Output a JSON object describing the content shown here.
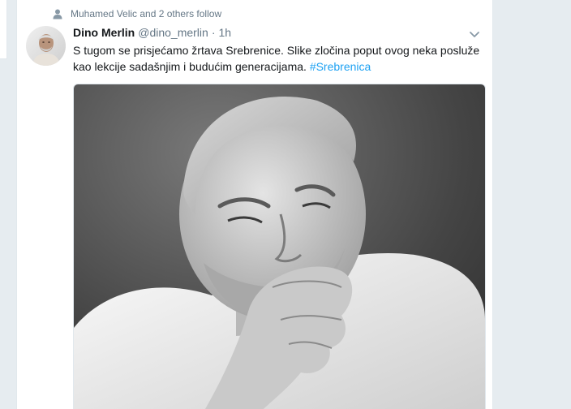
{
  "context": {
    "text": "Muhamed Velic and 2 others follow",
    "icon": "person-icon"
  },
  "tweet": {
    "author_name": "Dino Merlin",
    "author_handle": "@dino_merlin",
    "separator": "·",
    "timestamp": "1h",
    "text_body": "S tugom se prisjećamo žrtava Srebrenice. Slike zločina poput ovog neka posluže kao lekcije sadašnjim i budućim generacijama.",
    "hashtag": "#Srebrenica",
    "avatar_icon": "avatar-photo",
    "menu_icon": "chevron-down-icon",
    "media": "black-and-white portrait photo"
  },
  "colors": {
    "background": "#e6ecf0",
    "card": "#ffffff",
    "text_primary": "#14171a",
    "text_secondary": "#657786",
    "link": "#1da1f2"
  }
}
